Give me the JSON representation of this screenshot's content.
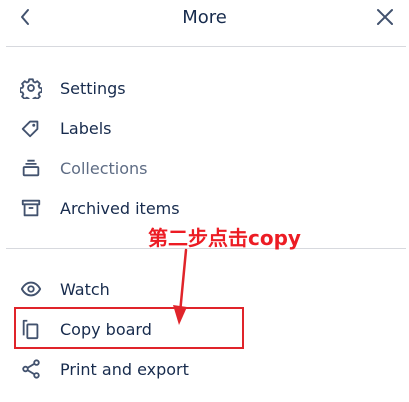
{
  "header": {
    "title": "More",
    "back_icon": "chevron-left-icon",
    "close_icon": "close-icon"
  },
  "menu_group_1": [
    {
      "label": "Settings",
      "icon": "gear-icon"
    },
    {
      "label": "Labels",
      "icon": "tag-icon"
    },
    {
      "label": "Collections",
      "icon": "collections-icon",
      "disabled": true
    },
    {
      "label": "Archived items",
      "icon": "archive-icon"
    }
  ],
  "menu_group_2": [
    {
      "label": "Watch",
      "icon": "eye-icon"
    },
    {
      "label": "Copy board",
      "icon": "copy-icon"
    },
    {
      "label": "Print and export",
      "icon": "share-icon"
    }
  ],
  "annotation": {
    "text": "第二步点击copy",
    "color": "#ec1c24"
  },
  "colors": {
    "text": "#172b4d",
    "muted_text": "#5e6c84",
    "divider": "#d7d9de",
    "highlight_border": "#e0242a"
  }
}
